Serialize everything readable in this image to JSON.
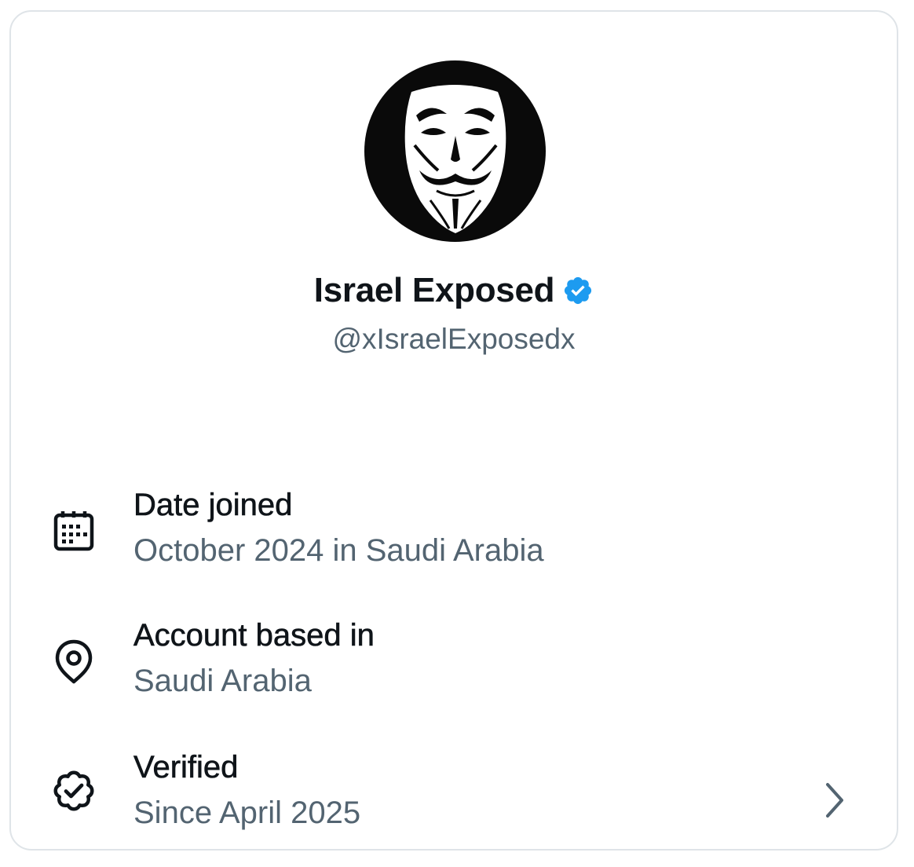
{
  "profile": {
    "display_name": "Israel Exposed",
    "handle": "@xIsraelExposedx"
  },
  "rows": [
    {
      "icon": "calendar-icon",
      "title": "Date joined",
      "value": "October 2024 in Saudi Arabia"
    },
    {
      "icon": "location-pin-icon",
      "title": "Account based in",
      "value": "Saudi Arabia"
    },
    {
      "icon": "verified-badge-icon",
      "title": "Verified",
      "value": "Since April 2025"
    }
  ],
  "colors": {
    "primary_text": "#0f1419",
    "secondary_text": "#536471",
    "verified_blue": "#1d9bf0",
    "border": "#dfe4e8"
  }
}
